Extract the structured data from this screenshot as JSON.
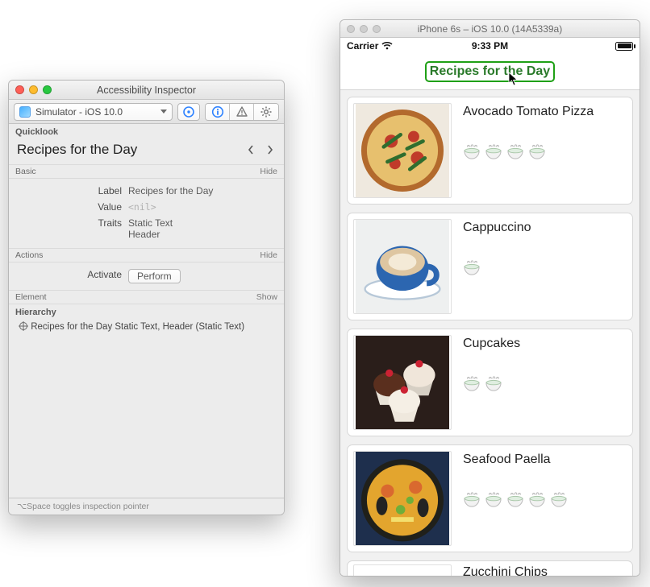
{
  "inspector": {
    "window_title": "Accessibility Inspector",
    "target_label": "Simulator - iOS 10.0",
    "quicklook_header": "Quicklook",
    "quicklook_title": "Recipes for the Day",
    "sections": {
      "basic": "Basic",
      "actions": "Actions",
      "element": "Element",
      "hierarchy": "Hierarchy"
    },
    "link_hide": "Hide",
    "link_show": "Show",
    "rows": {
      "label_k": "Label",
      "label_v": "Recipes for the Day",
      "value_k": "Value",
      "value_v": "<nil>",
      "traits_k": "Traits",
      "traits_v1": "Static Text",
      "traits_v2": "Header",
      "activate_k": "Activate",
      "perform_btn": "Perform"
    },
    "hierarchy_line": "Recipes for the Day Static Text, Header (Static Text)",
    "footer_hint": "⌥Space toggles inspection pointer"
  },
  "simulator": {
    "window_title": "iPhone 6s – iOS 10.0 (14A5339a)",
    "status": {
      "carrier": "Carrier",
      "time": "9:33 PM"
    },
    "header_title": "Recipes for the Day",
    "cards": [
      {
        "title": "Avocado Tomato Pizza",
        "rating": 4
      },
      {
        "title": "Cappuccino",
        "rating": 1
      },
      {
        "title": "Cupcakes",
        "rating": 2
      },
      {
        "title": "Seafood Paella",
        "rating": 5
      },
      {
        "title": "Zucchini Chips",
        "rating": 0
      }
    ]
  }
}
